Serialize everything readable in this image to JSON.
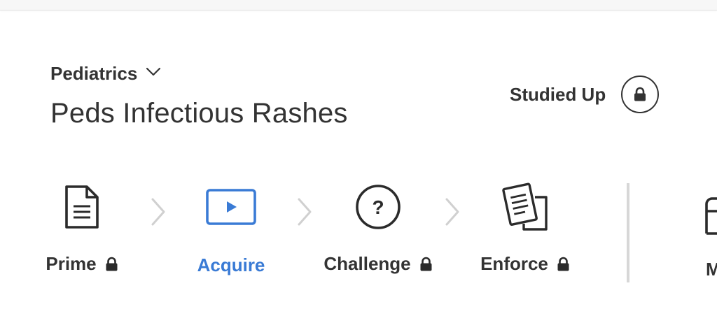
{
  "header": {
    "category": "Pediatrics",
    "title": "Peds Infectious Rashes",
    "studied_up_label": "Studied Up"
  },
  "steps": [
    {
      "label": "Prime",
      "icon": "document-icon",
      "locked": true,
      "active": false
    },
    {
      "label": "Acquire",
      "icon": "video-play-icon",
      "locked": false,
      "active": true
    },
    {
      "label": "Challenge",
      "icon": "question-icon",
      "locked": true,
      "active": false
    },
    {
      "label": "Enforce",
      "icon": "documents-icon",
      "locked": true,
      "active": false
    },
    {
      "label": "M",
      "icon": "box-icon",
      "locked": false,
      "active": false
    }
  ],
  "colors": {
    "active": "#3a7bd5",
    "text": "#333333",
    "chevron": "#d0d0d0",
    "divider": "#d7d7d7"
  }
}
